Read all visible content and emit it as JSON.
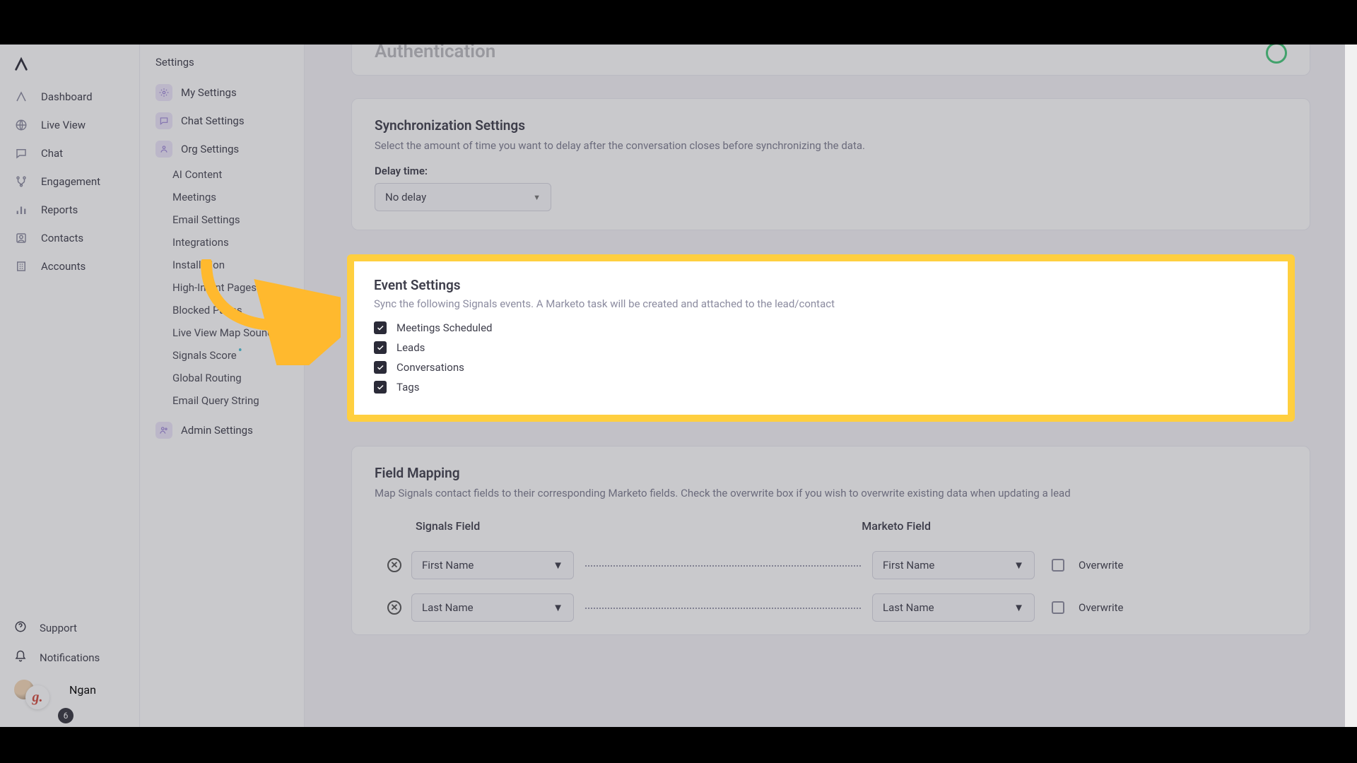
{
  "nav1": {
    "dashboard": "Dashboard",
    "live_view": "Live View",
    "chat": "Chat",
    "engagement": "Engagement",
    "reports": "Reports",
    "contacts": "Contacts",
    "accounts": "Accounts",
    "support": "Support",
    "notifications": "Notifications",
    "profile_name": "Ngan",
    "notif_count": "6"
  },
  "nav2": {
    "header": "Settings",
    "my_settings": "My Settings",
    "chat_settings": "Chat Settings",
    "org_settings": "Org Settings",
    "subs": {
      "ai_content": "AI Content",
      "meetings": "Meetings",
      "email_settings": "Email Settings",
      "integrations": "Integrations",
      "installation": "Installation",
      "high_intent": "High-Intent Pages",
      "blocked": "Blocked Pages",
      "live_view_sounds": "Live View Map Sounds",
      "signals_score": "Signals Score",
      "global_routing": "Global Routing",
      "email_query": "Email Query String"
    },
    "admin": "Admin Settings"
  },
  "auth": {
    "title": "Authentication"
  },
  "sync": {
    "title": "Synchronization Settings",
    "desc": "Select the amount of time you want to delay after the conversation closes before synchronizing the data.",
    "delay_label": "Delay time:",
    "delay_value": "No delay"
  },
  "event": {
    "title": "Event Settings",
    "desc": "Sync the following Signals events. A Marketo task will be created and attached to the lead/contact",
    "meetings": "Meetings Scheduled",
    "leads": "Leads",
    "conversations": "Conversations",
    "tags": "Tags"
  },
  "mapping": {
    "title": "Field Mapping",
    "desc": "Map Signals contact fields to their corresponding Marketo fields. Check the overwrite box if you wish to overwrite existing data when updating a lead",
    "col_signals": "Signals Field",
    "col_marketo": "Marketo Field",
    "overwrite": "Overwrite",
    "rows": [
      {
        "s": "First Name",
        "m": "First Name"
      },
      {
        "s": "Last Name",
        "m": "Last Name"
      }
    ]
  }
}
